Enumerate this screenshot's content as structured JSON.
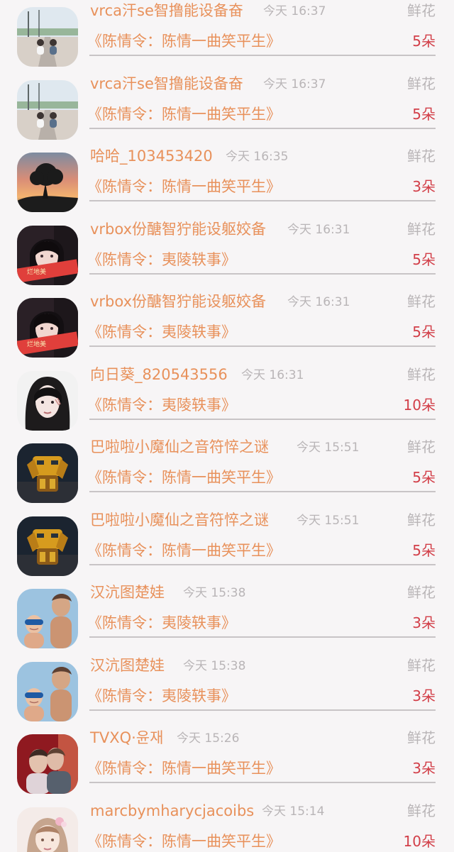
{
  "colors": {
    "background": "#f7f5f6",
    "accent_text": "#e8915b",
    "muted_text": "#b9b5b7",
    "count_text": "#d23e48",
    "divider": "#c8c4c6"
  },
  "records": [
    {
      "user": "vrca汗se智撸能设备奋",
      "time": "今天 16:37",
      "gift_type": "鲜花",
      "drama": "《陈情令：陈情一曲笑平生》",
      "count": "5朵",
      "avatar_icon": "couple-road-avatar-icon"
    },
    {
      "user": "vrca汗se智撸能设备奋",
      "time": "今天 16:37",
      "gift_type": "鲜花",
      "drama": "《陈情令：陈情一曲笑平生》",
      "count": "5朵",
      "avatar_icon": "couple-road-avatar-icon"
    },
    {
      "user": "哈哈_103453420",
      "time": "今天 16:35",
      "gift_type": "鲜花",
      "drama": "《陈情令：陈情一曲笑平生》",
      "count": "3朵",
      "avatar_icon": "sunset-tree-avatar-icon"
    },
    {
      "user": "vrbox份醣智狞能设躯姣备",
      "time": "今天 16:31",
      "gift_type": "鲜花",
      "drama": "《陈情令：夷陵轶事》",
      "count": "5朵",
      "avatar_icon": "girl-banner-avatar-icon"
    },
    {
      "user": "vrbox份醣智狞能设躯姣备",
      "time": "今天 16:31",
      "gift_type": "鲜花",
      "drama": "《陈情令：夷陵轶事》",
      "count": "5朵",
      "avatar_icon": "girl-banner-avatar-icon"
    },
    {
      "user": "向日葵_820543556",
      "time": "今天 16:31",
      "gift_type": "鲜花",
      "drama": "《陈情令：夷陵轶事》",
      "count": "10朵",
      "avatar_icon": "girl-portrait-avatar-icon"
    },
    {
      "user": "巴啦啦小魔仙之音符悴之谜",
      "time": "今天 15:51",
      "gift_type": "鲜花",
      "drama": "《陈情令：陈情一曲笑平生》",
      "count": "5朵",
      "avatar_icon": "robot-avatar-icon"
    },
    {
      "user": "巴啦啦小魔仙之音符悴之谜",
      "time": "今天 15:51",
      "gift_type": "鲜花",
      "drama": "《陈情令：陈情一曲笑平生》",
      "count": "5朵",
      "avatar_icon": "robot-avatar-icon"
    },
    {
      "user": "汉沆图楚娃",
      "time": "今天 15:38",
      "gift_type": "鲜花",
      "drama": "《陈情令：夷陵轶事》",
      "count": "3朵",
      "avatar_icon": "beach-family-avatar-icon"
    },
    {
      "user": "汉沆图楚娃",
      "time": "今天 15:38",
      "gift_type": "鲜花",
      "drama": "《陈情令：夷陵轶事》",
      "count": "3朵",
      "avatar_icon": "beach-family-avatar-icon"
    },
    {
      "user": "TVXQ·윤재",
      "time": "今天 15:26",
      "gift_type": "鲜花",
      "drama": "《陈情令：陈情一曲笑平生》",
      "count": "3朵",
      "avatar_icon": "couple-avatar-icon"
    },
    {
      "user": "marcbymharycjacoibs",
      "time": "今天 15:14",
      "gift_type": "鲜花",
      "drama": "《陈情令：陈情一曲笑平生》",
      "count": "10朵",
      "avatar_icon": "illustrated-girl-avatar-icon"
    }
  ]
}
